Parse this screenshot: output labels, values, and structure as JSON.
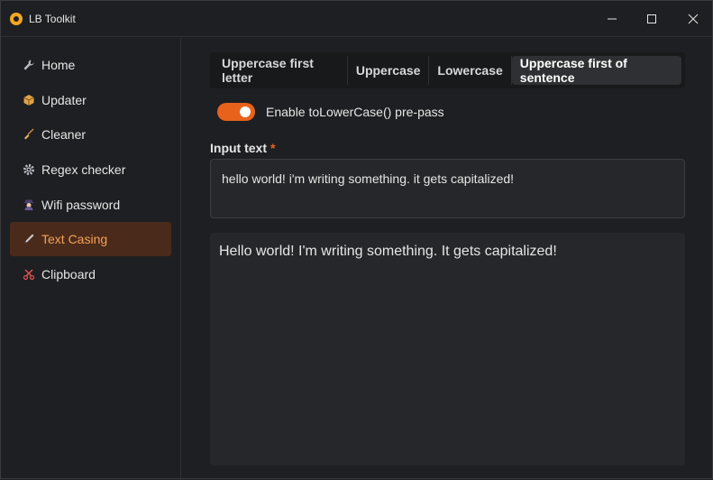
{
  "app": {
    "title": "LB Toolkit",
    "accent_color": "#e8621c"
  },
  "window_controls": {
    "minimize_icon": "minimize-icon",
    "maximize_icon": "maximize-icon",
    "close_icon": "close-icon"
  },
  "sidebar": {
    "items": [
      {
        "label": "Home",
        "icon": "wrench-icon",
        "active": false
      },
      {
        "label": "Updater",
        "icon": "package-icon",
        "active": false
      },
      {
        "label": "Cleaner",
        "icon": "broom-icon",
        "active": false
      },
      {
        "label": "Regex checker",
        "icon": "gear-icon",
        "active": false
      },
      {
        "label": "Wifi password",
        "icon": "detective-icon",
        "active": false
      },
      {
        "label": "Text Casing",
        "icon": "pen-icon",
        "active": true
      },
      {
        "label": "Clipboard",
        "icon": "scissors-icon",
        "active": false
      }
    ]
  },
  "tabs": [
    {
      "label": "Uppercase first letter",
      "active": false
    },
    {
      "label": "Uppercase",
      "active": false
    },
    {
      "label": "Lowercase",
      "active": false
    },
    {
      "label": "Uppercase first of sentence",
      "active": true
    }
  ],
  "toggle": {
    "label": "Enable toLowerCase() pre-pass",
    "checked": true
  },
  "input": {
    "label": "Input text",
    "required_marker": "*",
    "value": "hello world! i'm writing something. it gets capitalized!"
  },
  "output": {
    "value": "Hello world! I'm writing something. It gets capitalized!"
  }
}
